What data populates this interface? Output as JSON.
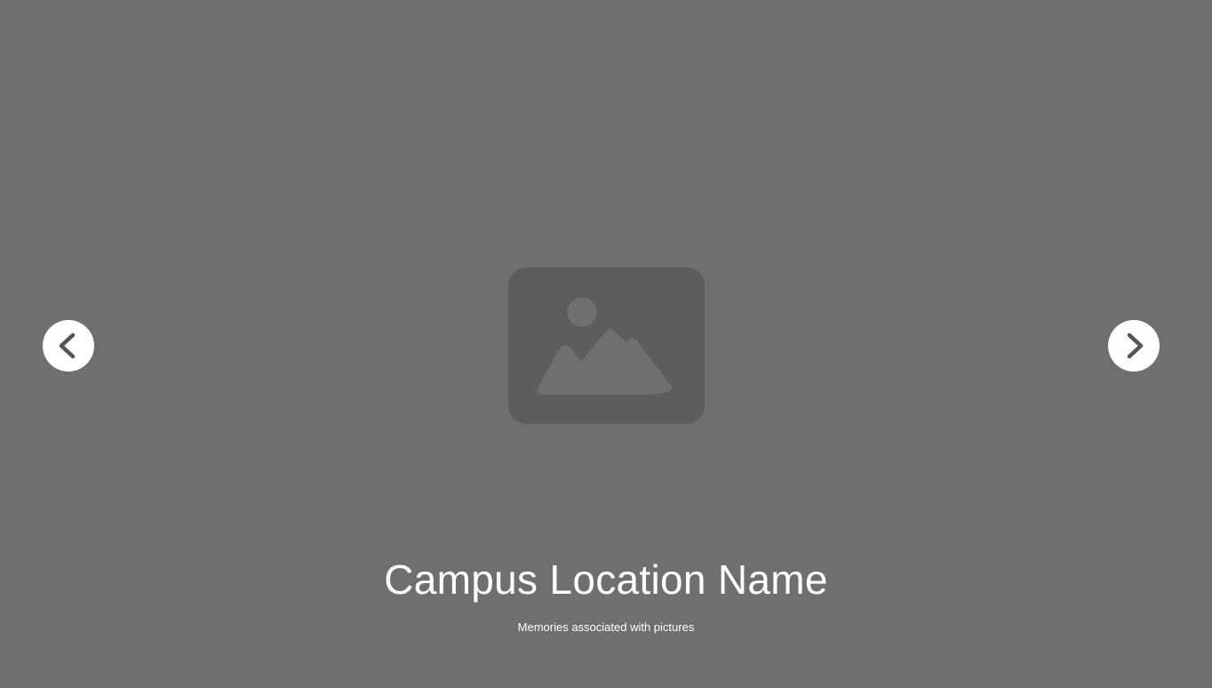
{
  "slide": {
    "title": "Campus Location Name",
    "subtitle": "Memories associated with pictures",
    "image_icon": "image-placeholder-icon"
  },
  "navigation": {
    "prev_icon": "chevron-left-icon",
    "next_icon": "chevron-right-icon"
  },
  "colors": {
    "background": "#6f6f6f",
    "placeholder": "#5d5d5d",
    "placeholder_glyph": "#6f6f6f",
    "button_bg": "#ffffff",
    "chevron": "#555555",
    "text": "#ffffff"
  }
}
